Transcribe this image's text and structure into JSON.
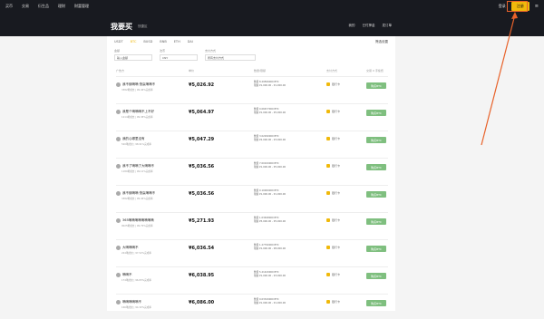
{
  "topnav": {
    "items": [
      "买币",
      "交易",
      "衍生品",
      "理财",
      "财富管理"
    ],
    "login": "登录",
    "signup": "注册",
    "menu_icon": "≡"
  },
  "hero": {
    "title": "我要买",
    "subtitle": "快捷区",
    "actions": [
      "我的",
      "已付押金",
      "发订单"
    ]
  },
  "tabs": {
    "items": [
      "USDT",
      "BTC",
      "BUSD",
      "BNB",
      "ETH",
      "DAI"
    ],
    "active_index": 1
  },
  "filter_button": "筛选设置",
  "filters": [
    {
      "label": "金额",
      "value": "输入金额"
    },
    {
      "label": "法币",
      "value": "CNY"
    },
    {
      "label": "支付方式",
      "value": "所有支付方式"
    }
  ],
  "columns": [
    "广告方",
    "单价",
    "数量/限额",
    "支付方式",
    "交易 0 手续费"
  ],
  "rows": [
    {
      "name": "我不倒嘀嘀 快赢嘀嘀不",
      "stats": "3382笔成交 | 99.46%完成率",
      "price": "¥5,026.92",
      "lim": "数量 8.29566000 BTC\n限额 ¥1,000.00 - ¥1,000.00",
      "pay": "银行卡",
      "buy": "购买BTC"
    },
    {
      "name": "我是个嘀嘀嘀不上不好",
      "stats": "1214笔成交 | 99.38%完成率",
      "price": "¥5,064.97",
      "lim": "数量 0.06677000 BTC\n限额 ¥1,000.00 - ¥5,000.00",
      "pay": "银行卡",
      "buy": "购买BTC"
    },
    {
      "name": "我的心哪里没有",
      "stats": "520笔成交 | 98.91%完成率",
      "price": "¥5,047.29",
      "lim": "数量 3.02290000 BTC\n限额 ¥2,000.00 - ¥3,000.00",
      "pay": "银行卡",
      "buy": "购买BTC"
    },
    {
      "name": "我不了嘀嘀了大嘀嘀不",
      "stats": "1180笔成交 | 99.12%完成率",
      "price": "¥5,036.56",
      "lim": "数量 7.00100000 BTC\n限额 ¥1,000.00 - ¥5,000.00",
      "pay": "银行卡",
      "buy": "购买BTC"
    },
    {
      "name": "我不倒嘀嘀 快赢嘀嘀不",
      "stats": "3382笔成交 | 99.46%完成率",
      "price": "¥5,036.56",
      "lim": "数量 0.10000000 BTC\n限额 ¥1,000.00 - ¥1,000.00",
      "pay": "银行卡",
      "buy": "购买BTC"
    },
    {
      "name": "365嘀嘀嘀嘀嘀嘀嘀嘀",
      "stats": "9025笔成交 | 99.79%完成率",
      "price": "¥5,271.93",
      "lim": "数量 1.03498000 BTC\n限额 ¥5,000.00 - ¥5,000.00",
      "pay": "银行卡",
      "buy": "购买BTC"
    },
    {
      "name": "大嘀嘀嘀不",
      "stats": "224笔成交 | 97.52%完成率",
      "price": "¥6,036.54",
      "lim": "数量 1.27790000 BTC\n限额 ¥1,000.00 - ¥8,000.00",
      "pay": "银行卡",
      "buy": "购买BTC"
    },
    {
      "name": "嘀嘀不",
      "stats": "174笔成交 | 96.83%完成率",
      "price": "¥6,038.95",
      "lim": "数量 5.21420000 BTC\n限额 ¥1,000.00 - ¥3,000.00",
      "pay": "银行卡",
      "buy": "购买BTC"
    },
    {
      "name": "嘀嘀嘀嘀嘀不",
      "stats": "166笔成交 | 94.32%完成率",
      "price": "¥6,086.00",
      "lim": "数量 0.03320000 BTC\n限额 ¥1,000.00 - ¥1,000.00",
      "pay": "银行卡",
      "buy": "购买BTC"
    }
  ],
  "colors": {
    "accent": "#f0b90b",
    "buy": "#7fbf7f",
    "highlight": "#e8622a"
  }
}
